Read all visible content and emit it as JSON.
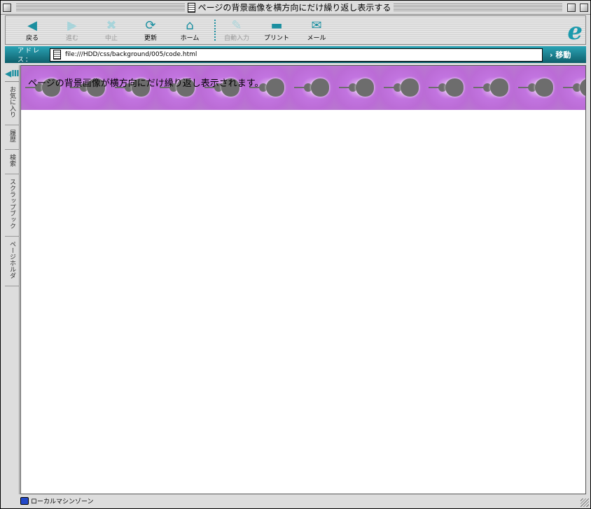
{
  "window": {
    "title": "ページの背景画像を横方向にだけ繰り返し表示する"
  },
  "toolbar": {
    "buttons": [
      {
        "label": "戻る",
        "icon": "back-icon",
        "enabled": true
      },
      {
        "label": "進む",
        "icon": "forward-icon",
        "enabled": false
      },
      {
        "label": "中止",
        "icon": "stop-icon",
        "enabled": false
      },
      {
        "label": "更新",
        "icon": "refresh-icon",
        "enabled": true
      },
      {
        "label": "ホーム",
        "icon": "home-icon",
        "enabled": true
      },
      {
        "label": "自動入力",
        "icon": "autofill-icon",
        "enabled": false
      },
      {
        "label": "プリント",
        "icon": "print-icon",
        "enabled": true
      },
      {
        "label": "メール",
        "icon": "mail-icon",
        "enabled": true
      }
    ]
  },
  "address": {
    "label": "アドレス：",
    "url": "file:///HDD/css/background/005/code.html",
    "go": "移動"
  },
  "sidebar": {
    "tabs": [
      "お気に入り",
      "履歴",
      "検索",
      "スクラップブック",
      "ページホルダ"
    ]
  },
  "page": {
    "text": "ページの背景画像が横方向にだけ繰り返し表示されます。"
  },
  "status": {
    "zone": "ローカルマシンゾーン"
  },
  "colors": {
    "accent": "#1b8fa0",
    "tile": "#c274e0"
  }
}
